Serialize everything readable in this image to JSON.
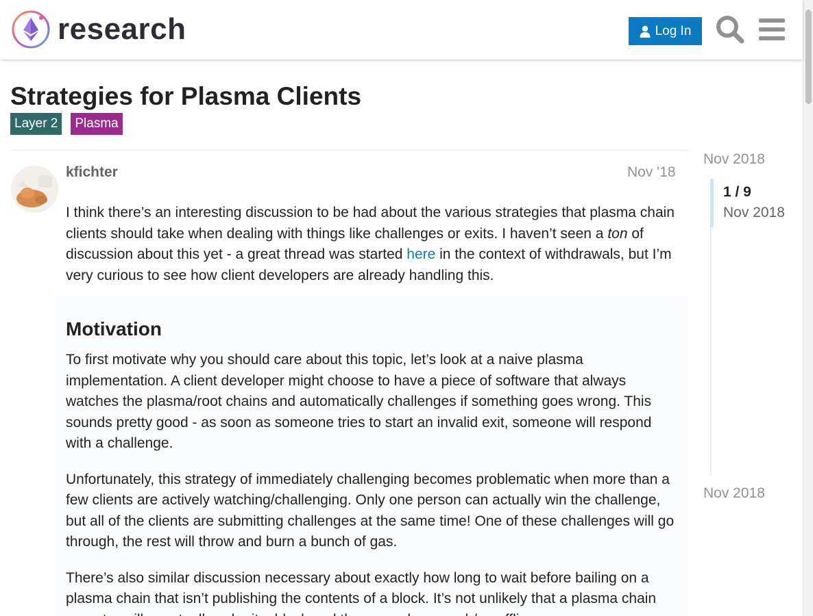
{
  "header": {
    "logo_text": "research",
    "login_label": "Log In",
    "search_icon": "search-icon",
    "menu_icon": "hamburger-menu-icon",
    "accent_color": "#0a7bc2"
  },
  "topic": {
    "title": "Strategies for Plasma Clients",
    "tags": [
      {
        "label": "Layer 2",
        "color": "#2f6a66"
      },
      {
        "label": "Plasma",
        "color": "#9a2a8e"
      }
    ]
  },
  "post": {
    "username": "kfichter",
    "date": "Nov '18",
    "p1_a": "I think there’s an interesting discussion to be had about the various strategies that plasma chain clients should take when dealing with things like challenges or exits. I haven’t seen a ",
    "p1_em": "ton",
    "p1_b": " of discussion about this yet - a great thread was started ",
    "p1_link": "here",
    "p1_c": " in the context of withdrawals, but I’m very curious to see how client developers are already handling this.",
    "heading": "Motivation",
    "p2": "To first motivate why you should care about this topic, let’s look at a naive plasma implementation. A client developer might choose to have a piece of software that always watches the plasma/root chains and automatically challenges if something goes wrong. This sounds pretty good - as soon as someone tries to start an invalid exit, someone will respond with a challenge.",
    "p3": "Unfortunately, this strategy of immediately challenging becomes problematic when more than a few clients are actively watching/challenging. Only one person can actually win the challenge, but all of the clients are submitting challenges at the same time! One of these challenges will go through, the rest will throw and burn a bunch of gas.",
    "p4": "There’s also similar discussion necessary about exactly how long to wait before bailing on a plasma chain that isn’t publishing the contents of a block. It’s not unlikely that a plasma chain operator will eventually submit a block and then somehow crash/go offline."
  },
  "timeline": {
    "start_date": "Nov 2018",
    "position": "1 / 9",
    "current_date": "Nov 2018",
    "end_date": "Nov 2018"
  }
}
